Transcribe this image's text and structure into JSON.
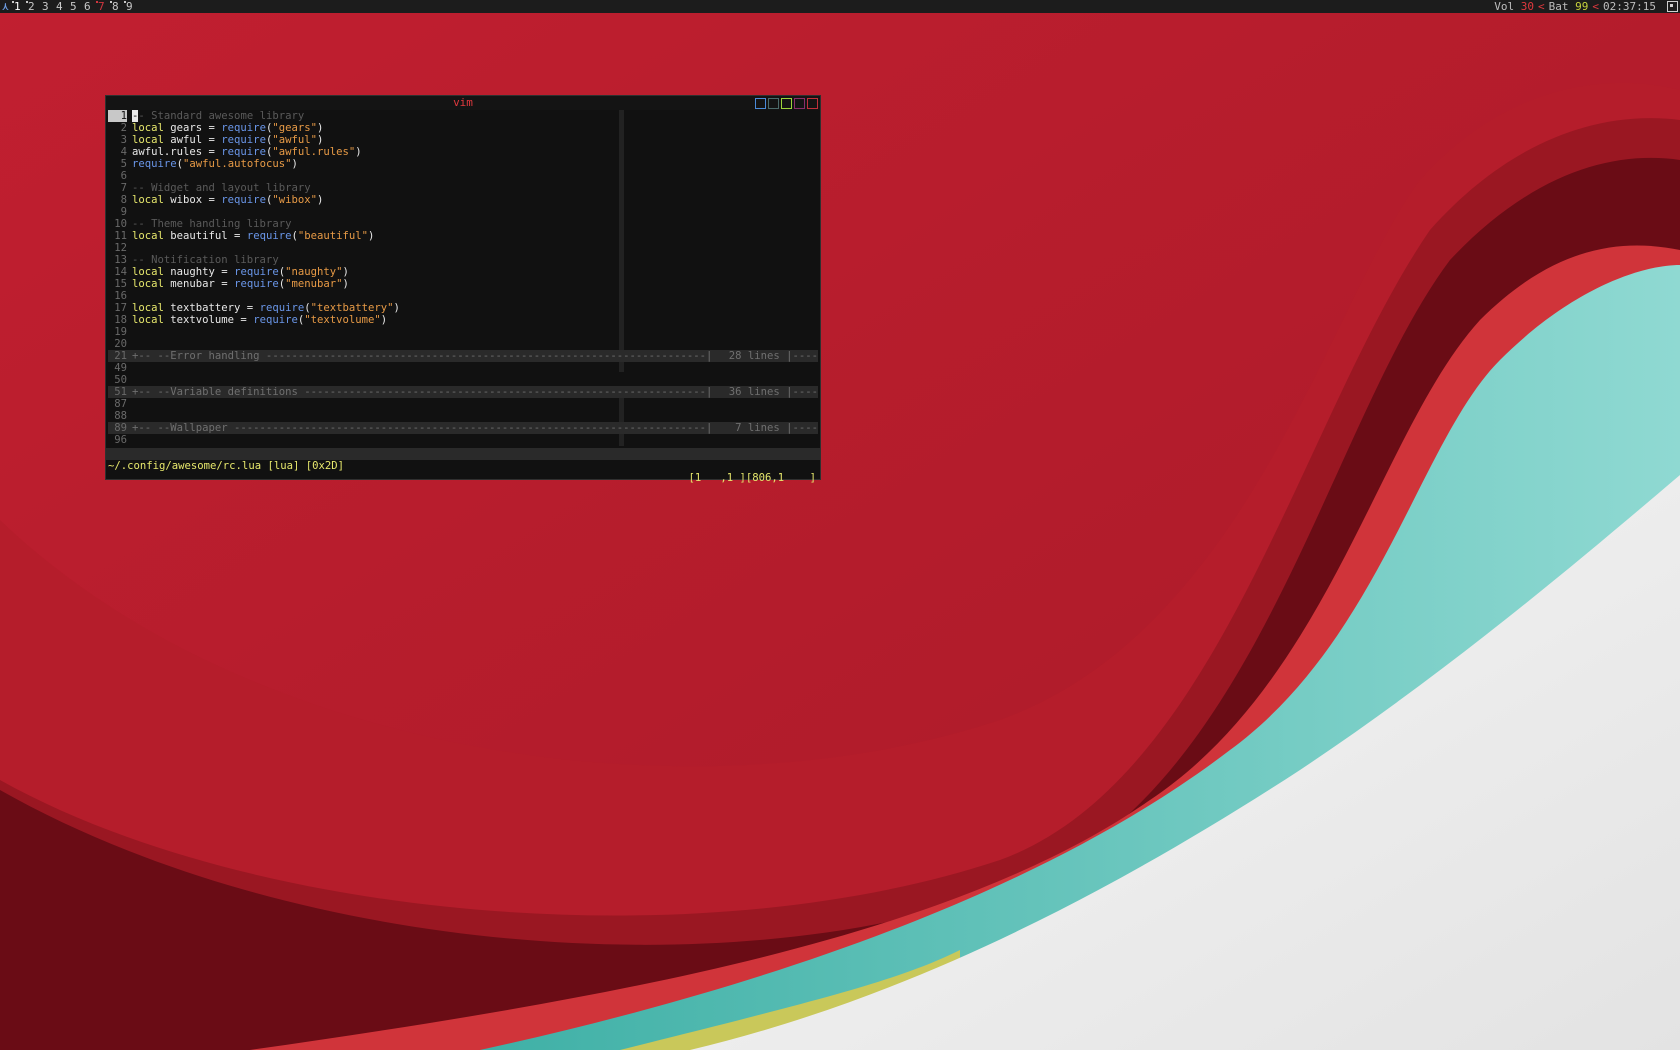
{
  "topbar": {
    "launcher_icon": "awesome-launcher-icon",
    "tags": [
      "1",
      "2",
      "3",
      "4",
      "5",
      "6",
      "7",
      "8",
      "9"
    ],
    "status": {
      "vol_label": "Vol",
      "vol_value": "30",
      "bat_label": "Bat",
      "bat_value": "99",
      "separator": "<",
      "clock": "02:37:15"
    },
    "layout_icon": "layout-tile-icon"
  },
  "window": {
    "title": "vim",
    "buttons": [
      "floating-icon",
      "ontop-icon",
      "sticky-icon",
      "maximize-icon",
      "close-icon"
    ]
  },
  "editor": {
    "lines": [
      {
        "n": "1",
        "segments": [
          {
            "t": "-",
            "c": "cur-char"
          },
          {
            "t": "- Standard awesome library",
            "c": "cm"
          }
        ]
      },
      {
        "n": "2",
        "segments": [
          {
            "t": "local",
            "c": "kw"
          },
          {
            "t": " gears = ",
            "c": ""
          },
          {
            "t": "require",
            "c": "fn"
          },
          {
            "t": "(",
            "c": ""
          },
          {
            "t": "\"gears\"",
            "c": "str"
          },
          {
            "t": ")",
            "c": ""
          }
        ]
      },
      {
        "n": "3",
        "segments": [
          {
            "t": "local",
            "c": "kw"
          },
          {
            "t": " awful = ",
            "c": ""
          },
          {
            "t": "require",
            "c": "fn"
          },
          {
            "t": "(",
            "c": ""
          },
          {
            "t": "\"awful\"",
            "c": "str"
          },
          {
            "t": ")",
            "c": ""
          }
        ]
      },
      {
        "n": "4",
        "segments": [
          {
            "t": "awful.rules = ",
            "c": ""
          },
          {
            "t": "require",
            "c": "fn"
          },
          {
            "t": "(",
            "c": ""
          },
          {
            "t": "\"awful.rules\"",
            "c": "str"
          },
          {
            "t": ")",
            "c": ""
          }
        ]
      },
      {
        "n": "5",
        "segments": [
          {
            "t": "require",
            "c": "fn"
          },
          {
            "t": "(",
            "c": ""
          },
          {
            "t": "\"awful.autofocus\"",
            "c": "str"
          },
          {
            "t": ")",
            "c": ""
          }
        ]
      },
      {
        "n": "6",
        "segments": []
      },
      {
        "n": "7",
        "segments": [
          {
            "t": "-- Widget and layout library",
            "c": "cm"
          }
        ]
      },
      {
        "n": "8",
        "segments": [
          {
            "t": "local",
            "c": "kw"
          },
          {
            "t": " wibox = ",
            "c": ""
          },
          {
            "t": "require",
            "c": "fn"
          },
          {
            "t": "(",
            "c": ""
          },
          {
            "t": "\"wibox\"",
            "c": "str"
          },
          {
            "t": ")",
            "c": ""
          }
        ]
      },
      {
        "n": "9",
        "segments": []
      },
      {
        "n": "10",
        "segments": [
          {
            "t": "-- Theme handling library",
            "c": "cm"
          }
        ]
      },
      {
        "n": "11",
        "segments": [
          {
            "t": "local",
            "c": "kw"
          },
          {
            "t": " beautiful = ",
            "c": ""
          },
          {
            "t": "require",
            "c": "fn"
          },
          {
            "t": "(",
            "c": ""
          },
          {
            "t": "\"beautiful\"",
            "c": "str"
          },
          {
            "t": ")",
            "c": ""
          }
        ]
      },
      {
        "n": "12",
        "segments": []
      },
      {
        "n": "13",
        "segments": [
          {
            "t": "-- Notification library",
            "c": "cm"
          }
        ]
      },
      {
        "n": "14",
        "segments": [
          {
            "t": "local",
            "c": "kw"
          },
          {
            "t": " naughty = ",
            "c": ""
          },
          {
            "t": "require",
            "c": "fn"
          },
          {
            "t": "(",
            "c": ""
          },
          {
            "t": "\"naughty\"",
            "c": "str"
          },
          {
            "t": ")",
            "c": ""
          }
        ]
      },
      {
        "n": "15",
        "segments": [
          {
            "t": "local",
            "c": "kw"
          },
          {
            "t": " menubar = ",
            "c": ""
          },
          {
            "t": "require",
            "c": "fn"
          },
          {
            "t": "(",
            "c": ""
          },
          {
            "t": "\"menubar\"",
            "c": "str"
          },
          {
            "t": ")",
            "c": ""
          }
        ]
      },
      {
        "n": "16",
        "segments": []
      },
      {
        "n": "17",
        "segments": [
          {
            "t": "local",
            "c": "kw"
          },
          {
            "t": " textbattery = ",
            "c": ""
          },
          {
            "t": "require",
            "c": "fn"
          },
          {
            "t": "(",
            "c": ""
          },
          {
            "t": "\"textbattery\"",
            "c": "str"
          },
          {
            "t": ")",
            "c": ""
          }
        ]
      },
      {
        "n": "18",
        "segments": [
          {
            "t": "local",
            "c": "kw"
          },
          {
            "t": " textvolume = ",
            "c": ""
          },
          {
            "t": "require",
            "c": "fn"
          },
          {
            "t": "(",
            "c": ""
          },
          {
            "t": "\"textvolume\"",
            "c": "str"
          },
          {
            "t": ")",
            "c": ""
          }
        ]
      },
      {
        "n": "19",
        "segments": []
      },
      {
        "n": "20",
        "segments": []
      },
      {
        "n": "21",
        "fold": true,
        "text": "+-- --Error handling ---------------------------------------------------------------------|",
        "count": "28 lines |----"
      },
      {
        "n": "49",
        "segments": []
      },
      {
        "n": "50",
        "segments": []
      },
      {
        "n": "51",
        "fold": true,
        "text": "+-- --Variable definitions ---------------------------------------------------------------|",
        "count": "36 lines |----"
      },
      {
        "n": "87",
        "segments": []
      },
      {
        "n": "88",
        "segments": []
      },
      {
        "n": "89",
        "fold": true,
        "text": "+-- --Wallpaper --------------------------------------------------------------------------|",
        "count": " 7 lines |----"
      },
      {
        "n": "96",
        "segments": []
      }
    ]
  },
  "statusline": {
    "file": "~/.config/awesome/rc.lua [lua] [0x2D]",
    "position": "[1   ,1 ][806,1    ]"
  },
  "colors": {
    "wallpaper_red": "#bc1f2e",
    "wallpaper_dark": "#5a0a12",
    "wallpaper_teal": "#5cc4ba",
    "wallpaper_light": "#eeeeee",
    "accent_red": "#e0393e",
    "accent_yellow": "#e6e76c",
    "accent_blue": "#6a96e8",
    "accent_orange": "#e79a46"
  }
}
